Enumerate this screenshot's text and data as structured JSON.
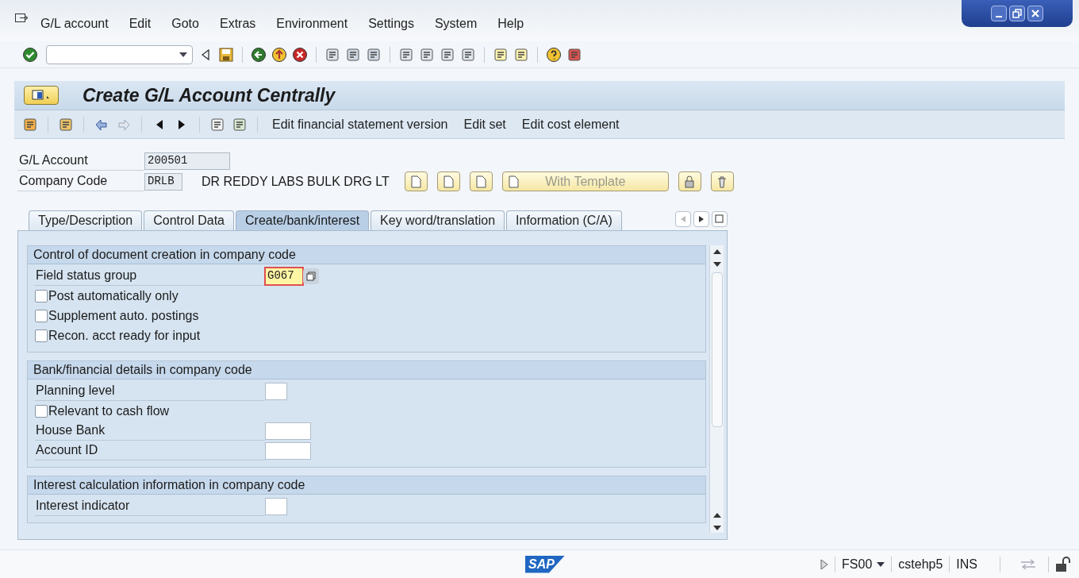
{
  "menu": [
    {
      "label": "G/L account"
    },
    {
      "label": "Edit"
    },
    {
      "label": "Goto"
    },
    {
      "label": "Extras"
    },
    {
      "label": "Environment"
    },
    {
      "label": "Settings"
    },
    {
      "label": "System"
    },
    {
      "label": "Help"
    }
  ],
  "title": "Create G/L Account Centrally",
  "app_toolbar": [
    "Edit financial statement version",
    "Edit set",
    "Edit cost element"
  ],
  "header_fields": [
    {
      "label": "G/L Account",
      "value": "200501"
    },
    {
      "label": "Company Code",
      "value": "DRLB",
      "description": "DR REDDY LABS BULK DRG LT"
    }
  ],
  "template_button": "With Template",
  "tabs": [
    {
      "label": "Type/Description",
      "selected": false
    },
    {
      "label": "Control Data",
      "selected": false
    },
    {
      "label": "Create/bank/interest",
      "selected": true
    },
    {
      "label": "Key word/translation",
      "selected": false
    },
    {
      "label": "Information (C/A)",
      "selected": false
    }
  ],
  "sections": [
    {
      "title": "Control of document creation in company code",
      "rows": [
        {
          "kind": "field",
          "label": "Field status group",
          "value": "G067",
          "focused": true
        },
        {
          "kind": "checkbox",
          "label": "Post automatically only",
          "checked": false
        },
        {
          "kind": "checkbox",
          "label": "Supplement auto. postings",
          "checked": false
        },
        {
          "kind": "checkbox",
          "label": "Recon. acct ready for input",
          "checked": false
        }
      ]
    },
    {
      "title": "Bank/financial details in company code",
      "rows": [
        {
          "kind": "field",
          "label": "Planning level",
          "focused": false
        },
        {
          "kind": "checkbox",
          "label": "Relevant to cash flow",
          "checked": false
        },
        {
          "kind": "field",
          "label": "House Bank",
          "focused": false
        },
        {
          "kind": "field",
          "label": "Account ID",
          "focused": false
        }
      ]
    },
    {
      "title": "Interest calculation information in company code",
      "rows": [
        {
          "kind": "field",
          "label": "Interest indicator",
          "focused": false
        }
      ]
    }
  ],
  "status_bar": {
    "logo": "SAP",
    "transaction": "FS00",
    "server": "cstehp5",
    "mode": "INS"
  }
}
